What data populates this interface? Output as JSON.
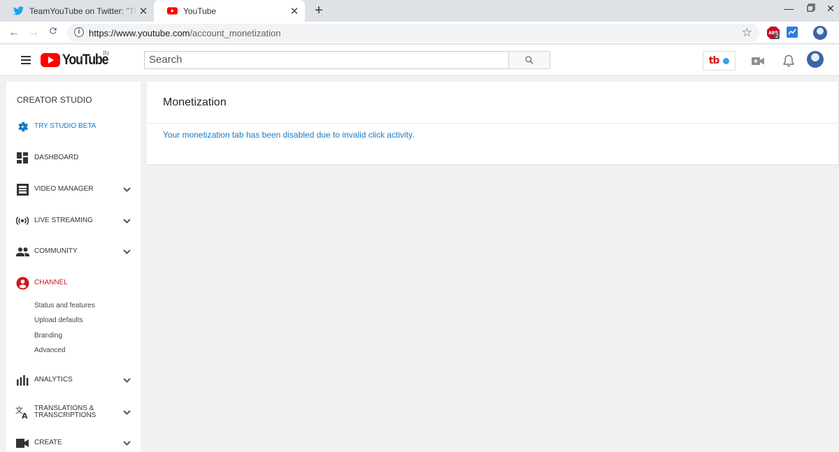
{
  "browser": {
    "tabs": [
      {
        "title": "TeamYouTube on Twitter: \"Thank",
        "icon": "twitter-icon"
      },
      {
        "title": "YouTube",
        "icon": "youtube-icon"
      }
    ],
    "url_host": "https://www.youtube.com",
    "url_path": "/account_monetization",
    "abp_badge": "2"
  },
  "header": {
    "logo_text": "YouTube",
    "country_code": "IN",
    "search_placeholder": "Search"
  },
  "sidebar": {
    "heading": "CREATOR STUDIO",
    "items": [
      {
        "label": "TRY STUDIO BETA",
        "icon": "gear-icon"
      },
      {
        "label": "DASHBOARD",
        "icon": "dashboard-icon"
      },
      {
        "label": "VIDEO MANAGER",
        "icon": "video-manager-icon"
      },
      {
        "label": "LIVE STREAMING",
        "icon": "live-streaming-icon"
      },
      {
        "label": "COMMUNITY",
        "icon": "people-icon"
      },
      {
        "label": "CHANNEL",
        "icon": "account-circle-icon"
      },
      {
        "label": "ANALYTICS",
        "icon": "bar-chart-icon"
      },
      {
        "label": "TRANSLATIONS &",
        "label2": "TRANSCRIPTIONS",
        "icon": "translate-icon"
      },
      {
        "label": "CREATE",
        "icon": "video-camera-icon"
      }
    ],
    "channel_subitems": [
      "Status and features",
      "Upload defaults",
      "Branding",
      "Advanced"
    ]
  },
  "main": {
    "title": "Monetization",
    "message": "Your monetization tab has been disabled due to invalid click activity."
  },
  "colors": {
    "youtube_red": "#ff0000",
    "link_blue": "#167ac6",
    "active_red": "#cc181e"
  }
}
